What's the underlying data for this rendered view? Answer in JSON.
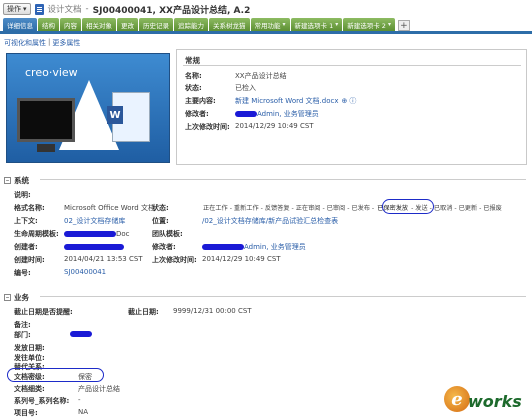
{
  "titlebar": {
    "op_button": "操作",
    "doc_type": "设计文档",
    "doc_name": "SJ00400041, XX产品设计总结, A.2"
  },
  "tabs": [
    {
      "label": "详细信息",
      "active": true
    },
    {
      "label": "结构"
    },
    {
      "label": "内容"
    },
    {
      "label": "相关对象"
    },
    {
      "label": "更改"
    },
    {
      "label": "历史记录"
    },
    {
      "label": "追踪能力"
    },
    {
      "label": "关系树龙猫"
    },
    {
      "label": "常用功能",
      "dropdown": true
    },
    {
      "label": "新建选项卡 1",
      "dropdown": true
    },
    {
      "label": "新建选项卡 2",
      "dropdown": true
    }
  ],
  "tab_add": "+",
  "sublinks": {
    "a": "可视化和属性",
    "sep": "|",
    "b": "更多属性"
  },
  "thumbnail": {
    "logo": "creo·view"
  },
  "general": {
    "title": "常规",
    "name_label": "名称:",
    "name_value": "XX产品设计总结",
    "status_label": "状态:",
    "status_value": "已检入",
    "content_label": "主要内容:",
    "content_value": "新建 Microsoft Word 文档.docx",
    "modifier_label": "修改者:",
    "modifier_value": "Admin, 业务管理员",
    "last_modified_label": "上次修改时间:",
    "last_modified_value": "2014/12/29 10:49 CST"
  },
  "system": {
    "title": "系统",
    "desc_label": "说明:",
    "format_label": "格式名称:",
    "format_value": "Microsoft Office Word 文档",
    "state_label": "状态:",
    "state_flow_pre": "正在工作 - 重新工作 - 反馈答复 - 正在审阅 - 已审阅 - 已发布 -",
    "state_current": "已保密发放",
    "state_flow_post": "- 发送 - 已取消 - 已更新 - 已报废",
    "context_label": "上下文:",
    "context_value": "02_设计文档存储库",
    "location_label": "位置:",
    "location_value": "/02_设计文档存储库/新产品试验汇总检查表",
    "lifecycle_label": "生命周期模板:",
    "lifecycle_value": "Doc",
    "team_label": "团队模板:",
    "creator_label": "创建者:",
    "modifier_label": "修改者:",
    "modifier_value": "Admin, 业务管理员",
    "created_label": "创建时间:",
    "created_value": "2014/04/21 13:53 CST",
    "last_modified_label": "上次修改时间:",
    "last_modified_value": "2014/12/29 10:49 CST",
    "number_label": "编号:",
    "number_value": "SJ00400041"
  },
  "business": {
    "title": "业务",
    "deadline_flag_label": "截止日期是否提醒:",
    "deadline_label": "截止日期:",
    "deadline_value": "9999/12/31 00:00 CST",
    "remark_label": "备注:",
    "dept_label": "部门:",
    "issue_date_label": "发放日期:",
    "issue_unit_label": "发往单位:",
    "replace_label": "替代关系:",
    "secret_label": "文档密级:",
    "secret_value": "保密",
    "category_label": "文档细类:",
    "category_value": "产品设计总结",
    "series_label": "系列号_系列名称:",
    "series_value": "-",
    "project_label": "项目号:",
    "project_value": "NA"
  },
  "watermark": {
    "e": "e",
    "text": "works"
  }
}
